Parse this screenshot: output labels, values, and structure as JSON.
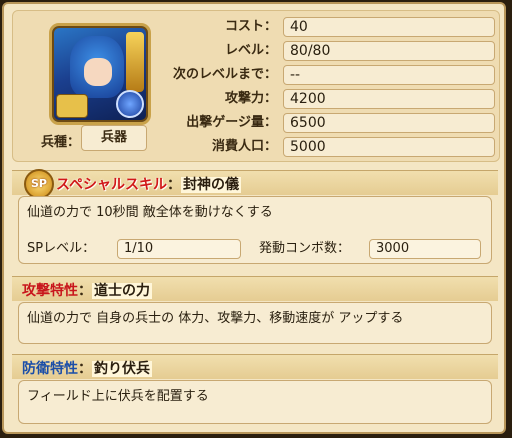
{
  "unit": {
    "type_label": "兵種：",
    "type_value": "兵器",
    "icon": "unit-portrait"
  },
  "stats": [
    {
      "label": "コスト：",
      "value": "40"
    },
    {
      "label": "レベル：",
      "value": "80/80"
    },
    {
      "label": "次のレベルまで：",
      "value": "--"
    },
    {
      "label": "攻撃力：",
      "value": "4200"
    },
    {
      "label": "出撃ゲージ量：",
      "value": "6500"
    },
    {
      "label": "消費人口：",
      "value": "5000"
    }
  ],
  "special_skill": {
    "badge": "SP",
    "title": "スペシャルスキル",
    "separator": "：",
    "name": "封神の儀",
    "description": "仙道の力で 10秒間 敵全体を動けなくする",
    "sp_level_label": "SPレベル：",
    "sp_level_value": "1/10",
    "combo_label": "発動コンボ数：",
    "combo_value": "3000"
  },
  "attack_trait": {
    "title": "攻撃特性",
    "separator": "：",
    "name": "道士の力",
    "description": "仙道の力で 自身の兵士の 体力、攻撃力、移動速度が アップする"
  },
  "defense_trait": {
    "title": "防衛特性",
    "separator": "：",
    "name": "釣り伏兵",
    "description": "フィールド上に伏兵を配置する"
  }
}
